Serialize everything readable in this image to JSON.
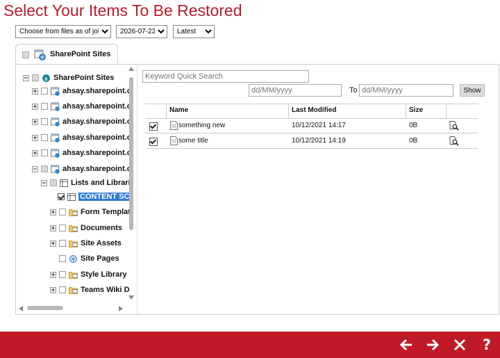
{
  "page_title": "Select Your Items To Be Restored",
  "filters": {
    "mode": "Choose from files as of job",
    "date": "2026-07-23",
    "version": "Latest"
  },
  "tab": {
    "label": "SharePoint Sites"
  },
  "tree": {
    "root": "SharePoint Sites",
    "sites": [
      "ahsay.sharepoint.c",
      "ahsay.sharepoint.c",
      "ahsay.sharepoint.c",
      "ahsay.sharepoint.c",
      "ahsay.sharepoint.c",
      "ahsay.sharepoint.c"
    ],
    "lists_node": "Lists and Librari",
    "selected_node": "CONTENT SC",
    "children": [
      "Form Templat",
      "Documents",
      "Site Assets",
      "Site Pages",
      "Style Library",
      "Teams Wiki D"
    ]
  },
  "search": {
    "keyword_placeholder": "Keyword Quick Search",
    "from_placeholder": "dd/MM/yyyy",
    "to_label": "To",
    "to_placeholder": "dd/MM/yyyy",
    "show_label": "Show"
  },
  "grid": {
    "columns": [
      "Name",
      "Last Modified",
      "Size"
    ],
    "rows": [
      {
        "name": "something new",
        "modified": "10/12/2021 14:17",
        "size": "0B"
      },
      {
        "name": "some title",
        "modified": "10/12/2021 14:19",
        "size": "0B"
      }
    ]
  },
  "footer": {
    "back_label": "Back",
    "next_label": "Next",
    "cancel_label": "Cancel",
    "help_label": "Help"
  },
  "colors": {
    "brand": "#c01a28",
    "title": "#b81c2a",
    "selection": "#2f7bd8"
  }
}
